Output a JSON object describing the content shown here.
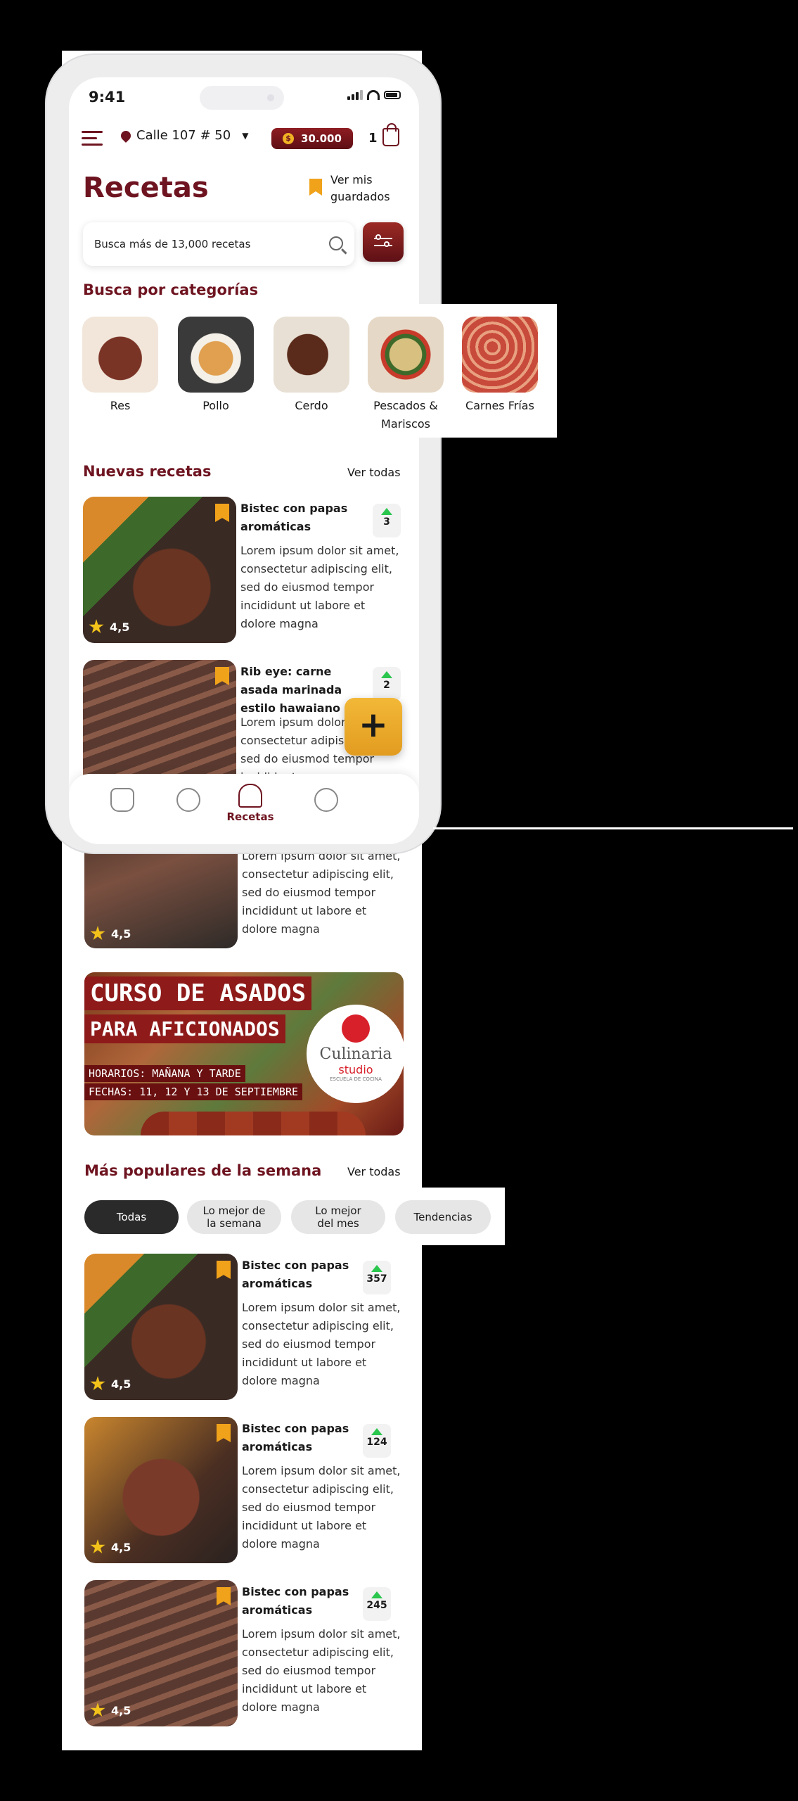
{
  "status_bar": {
    "time": "9:41"
  },
  "header": {
    "location": "Calle 107 # 50",
    "coins": "30.000",
    "coin_symbol": "$",
    "cart_count": "1"
  },
  "title": "Recetas",
  "saved_link": "Ver mis guardados",
  "search": {
    "placeholder": "Busca más de 13,000 recetas"
  },
  "categories_section": {
    "title": "Busca por categorías",
    "items": [
      {
        "label": "Res"
      },
      {
        "label": "Pollo"
      },
      {
        "label": "Cerdo"
      },
      {
        "label": "Pescados & Mariscos"
      },
      {
        "label": "Carnes Frías"
      }
    ]
  },
  "new_recipes": {
    "title": "Nuevas recetas",
    "see_all": "Ver todas",
    "items": [
      {
        "name": "Bistec con papas aromáticas",
        "description": "Lorem ipsum dolor sit amet, consectetur adipiscing elit, sed do eiusmod tempor incididunt ut labore et dolore magna",
        "rating": "4,5",
        "votes": "3"
      },
      {
        "name": "Rib eye: carne asada marinada estilo hawaiano",
        "description": "Lorem ipsum dolor sit amet, consectetur adipiscing elit, sed do eiusmod tempor incididunt",
        "votes": "2"
      },
      {
        "description": "Lorem ipsum dolor sit amet, consectetur adipiscing elit, sed do eiusmod tempor incididunt ut labore et dolore magna",
        "rating": "4,5"
      }
    ]
  },
  "fab": {
    "label": "+"
  },
  "bottom_nav": {
    "active_label": "Recetas"
  },
  "banner": {
    "title": "CURSO DE ASADOS",
    "subtitle": "PARA AFICIONADOS",
    "hours": "HORARIOS: MAÑANA Y TARDE",
    "dates": "FECHAS: 11, 12 Y 13 DE SEPTIEMBRE",
    "logo_word": "Culinaria",
    "logo_studio": "studio",
    "logo_tagline": "ESCUELA DE COCINA"
  },
  "popular": {
    "title": "Más populares de la semana",
    "see_all": "Ver todas",
    "tabs": [
      {
        "label": "Todas"
      },
      {
        "label": "Lo mejor de la semana"
      },
      {
        "label": "Lo mejor del mes"
      },
      {
        "label": "Tendencias"
      }
    ],
    "items": [
      {
        "name": "Bistec con papas aromáticas",
        "description": "Lorem ipsum dolor sit amet, consectetur adipiscing elit, sed do eiusmod tempor incididunt ut labore et dolore magna",
        "rating": "4,5",
        "votes": "357"
      },
      {
        "name": "Bistec con papas aromáticas",
        "description": "Lorem ipsum dolor sit amet, consectetur adipiscing elit, sed do eiusmod tempor incididunt ut labore et dolore magna",
        "rating": "4,5",
        "votes": "124"
      },
      {
        "name": "Bistec con papas aromáticas",
        "description": "Lorem ipsum dolor sit amet, consectetur adipiscing elit, sed do eiusmod tempor incididunt ut labore et dolore magna",
        "rating": "4,5",
        "votes": "245"
      }
    ]
  },
  "colors": {
    "brand": "#6e1420",
    "accent": "#f0a21a",
    "vote_up": "#2ac64e"
  },
  "icons": [
    "menu-icon",
    "location-pin-icon",
    "coin-icon",
    "shopping-bag-icon",
    "bookmark-icon",
    "search-icon",
    "filter-icon",
    "star-icon",
    "arrow-up-icon",
    "home-icon",
    "explore-food-icon",
    "chef-hat-icon",
    "compass-icon"
  ]
}
